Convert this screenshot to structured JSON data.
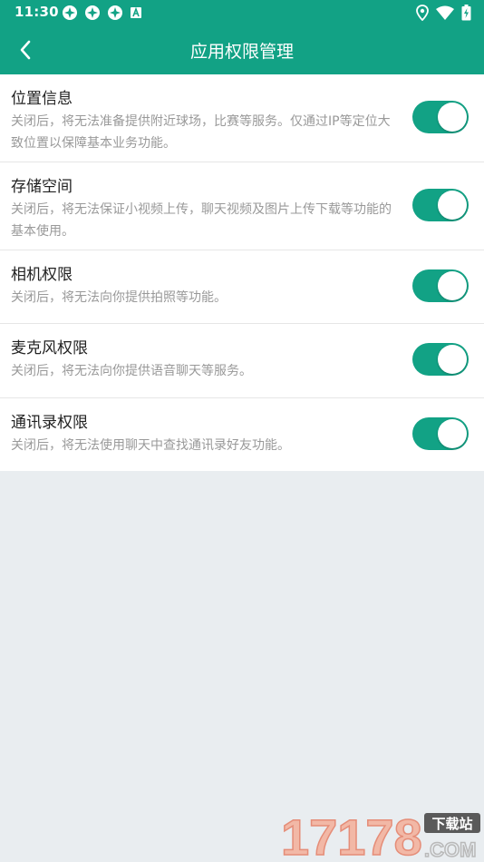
{
  "status_bar": {
    "time": "11:30",
    "left_icons": [
      "app-notification-icon",
      "app-notification-icon",
      "app-notification-icon",
      "a-notification-icon"
    ],
    "right_icons": [
      "location-icon",
      "wifi-icon",
      "battery-charging-icon"
    ]
  },
  "header": {
    "title": "应用权限管理",
    "back_icon": "chevron-left-icon",
    "background": "#12a285"
  },
  "permissions": [
    {
      "title": "位置信息",
      "description": "关闭后，将无法准备提供附近球场，比赛等服务。仅通过IP等定位大致位置以保障基本业务功能。",
      "enabled": true
    },
    {
      "title": "存储空间",
      "description": "关闭后，将无法保证小视频上传，聊天视频及图片上传下载等功能的基本使用。",
      "enabled": true
    },
    {
      "title": "相机权限",
      "description": "关闭后，将无法向你提供拍照等功能。",
      "enabled": true
    },
    {
      "title": "麦克风权限",
      "description": "关闭后，将无法向你提供语音聊天等服务。",
      "enabled": true
    },
    {
      "title": "通讯录权限",
      "description": "关闭后，将无法使用聊天中查找通讯录好友功能。",
      "enabled": true
    }
  ],
  "colors": {
    "accent": "#12a285",
    "background": "#e9edf0"
  },
  "watermark": {
    "text": "17178",
    "badge": "下载站",
    "suffix": ".COM"
  }
}
